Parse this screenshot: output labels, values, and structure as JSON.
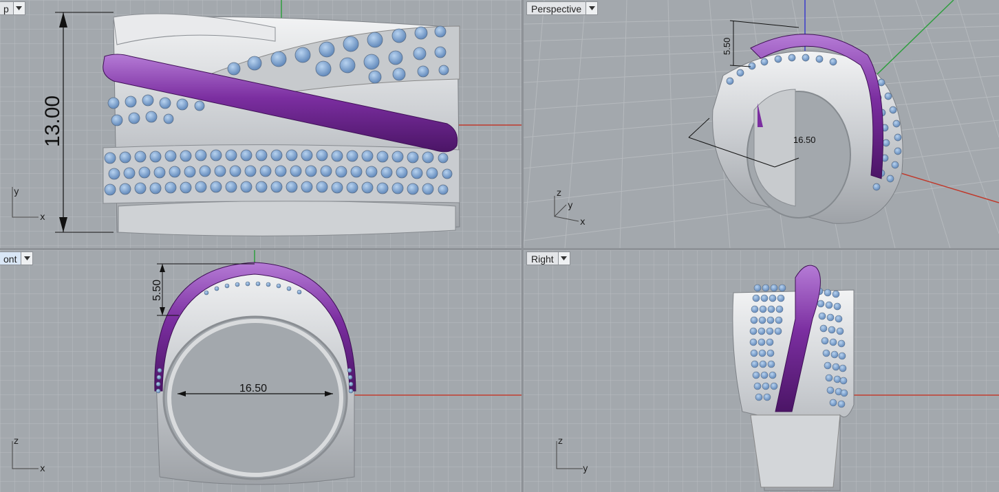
{
  "viewports": {
    "top": {
      "title": "p",
      "dim_vertical": "13.00",
      "axis_a": "y",
      "axis_b": "x"
    },
    "perspective": {
      "title": "Perspective",
      "dim_height": "5.50",
      "dim_width": "16.50",
      "axis_z": "z",
      "axis_y": "y",
      "axis_x": "x"
    },
    "front": {
      "title": "ont",
      "dim_height": "5.50",
      "dim_width": "16.50",
      "axis_a": "z",
      "axis_b": "x"
    },
    "right": {
      "title": "Right",
      "axis_a": "z",
      "axis_b": "y"
    }
  },
  "colors": {
    "background": "#a3a8ad",
    "grid_line": "#b6babe",
    "grid_major": "#8c9095",
    "metal": "#d7d9db",
    "band_purple": "#7b2ea0",
    "stone": "#7fa4d0",
    "axis_x": "#c0392b",
    "axis_y": "#2e9e3e",
    "axis_z": "#3b3bcc"
  }
}
